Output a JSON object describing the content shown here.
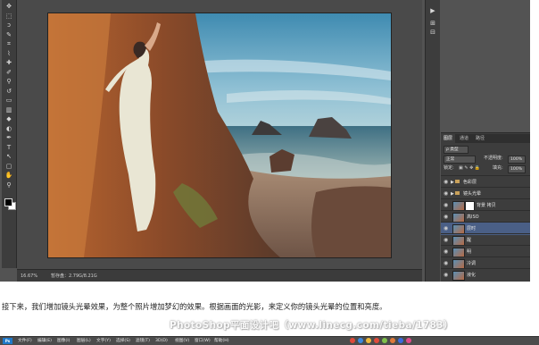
{
  "statusbar": {
    "zoom": "16.67%",
    "doc_size": "暂存盘：2.79G/8.21G"
  },
  "tools": [
    "move-tool",
    "marquee-tool",
    "lasso-tool",
    "quick-select-tool",
    "crop-tool",
    "eyedropper-tool",
    "healing-brush-tool",
    "brush-tool",
    "clone-stamp-tool",
    "history-brush-tool",
    "eraser-tool",
    "gradient-tool",
    "blur-tool",
    "dodge-tool",
    "pen-tool",
    "type-tool",
    "path-select-tool",
    "shape-tool",
    "hand-tool",
    "zoom-tool"
  ],
  "tool_glyphs": [
    "✥",
    "⬚",
    "ↄ",
    "✎",
    "⌗",
    "⌇",
    "✚",
    "✐",
    "⚲",
    "↺",
    "▭",
    "▥",
    "◆",
    "◐",
    "✒",
    "T",
    "↖",
    "▢",
    "✋",
    "⚲"
  ],
  "layers_panel": {
    "tabs": [
      "图层",
      "通道",
      "路径"
    ],
    "kind_label": "ρ 类型",
    "blend_mode": "正常",
    "opacity_label": "不透明度:",
    "opacity_value": "100%",
    "lock_label": "锁定:",
    "fill_label": "填充:",
    "fill_value": "100%",
    "layers": [
      {
        "name": "色彩层",
        "type": "group"
      },
      {
        "name": "镜头光晕",
        "type": "group"
      },
      {
        "name": "背景 拷贝",
        "type": "mask"
      },
      {
        "name": "高ISO",
        "type": "normal"
      },
      {
        "name": "层时",
        "type": "normal",
        "selected": true
      },
      {
        "name": "醒",
        "type": "normal"
      },
      {
        "name": "明",
        "type": "normal"
      },
      {
        "name": "冷调",
        "type": "normal"
      },
      {
        "name": "液化",
        "type": "normal"
      }
    ]
  },
  "caption": "接下来，我们增加镜头光晕效果，为整个照片增加梦幻的效果。根据画面的光影，来定义你的镜头光晕的位置和亮度。",
  "watermark": "PhotoShop平面设计吧（www.linecg.com/tieba/1783）",
  "menubar": {
    "logo": "Ps",
    "items": [
      "文件(F)",
      "编辑(E)",
      "图像(I)",
      "图层(L)",
      "文字(Y)",
      "选择(S)",
      "滤镜(T)",
      "3D(D)",
      "视图(V)",
      "窗口(W)",
      "帮助(H)"
    ]
  },
  "colors": {
    "accent_selected_layer": "#4a5f86",
    "workspace": "#535353",
    "panel": "#3d3d3d"
  }
}
